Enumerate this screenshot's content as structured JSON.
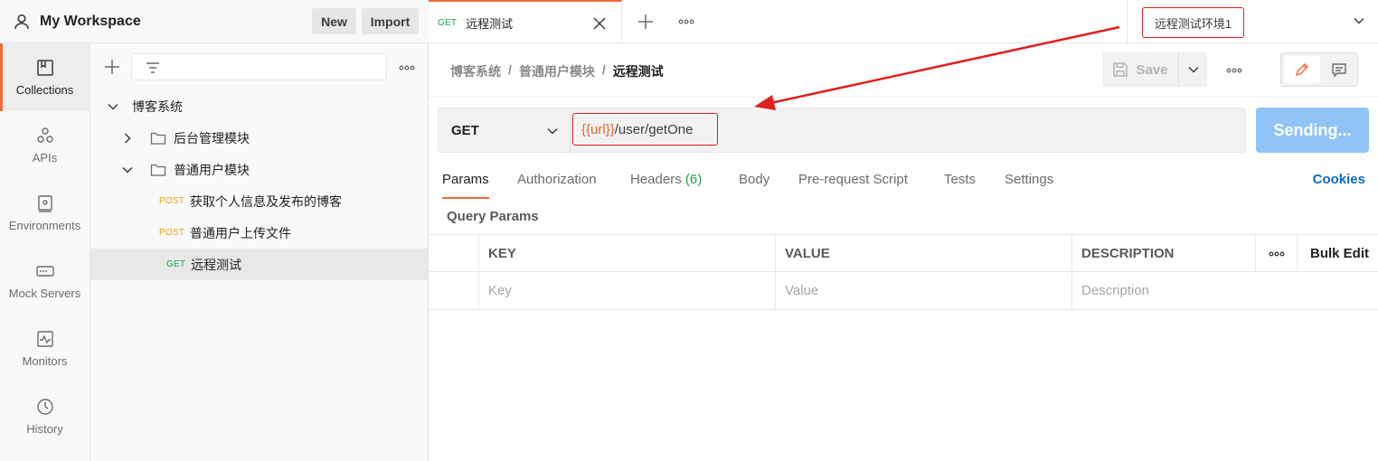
{
  "workspace": {
    "title": "My Workspace",
    "new_label": "New",
    "import_label": "Import"
  },
  "rail": {
    "items": [
      {
        "label": "Collections",
        "icon": "collections-icon",
        "active": true
      },
      {
        "label": "APIs",
        "icon": "apis-icon"
      },
      {
        "label": "Environments",
        "icon": "environments-icon"
      },
      {
        "label": "Mock Servers",
        "icon": "mock-servers-icon"
      },
      {
        "label": "Monitors",
        "icon": "monitors-icon"
      },
      {
        "label": "History",
        "icon": "history-icon"
      }
    ]
  },
  "tree": {
    "collection": "博客系统",
    "folders": [
      {
        "name": "后台管理模块",
        "expanded": false
      },
      {
        "name": "普通用户模块",
        "expanded": true
      }
    ],
    "requests": [
      {
        "method": "POST",
        "name": "获取个人信息及发布的博客"
      },
      {
        "method": "POST",
        "name": "普通用户上传文件"
      },
      {
        "method": "GET",
        "name": "远程测试",
        "selected": true
      }
    ]
  },
  "tab": {
    "method": "GET",
    "title": "远程测试"
  },
  "environment": {
    "selected": "远程测试环境1"
  },
  "breadcrumb": {
    "items": [
      "博客系统",
      "普通用户模块"
    ],
    "sep": "/",
    "current": "远程测试"
  },
  "save": {
    "label": "Save"
  },
  "request": {
    "method": "GET",
    "url_var": "{{url}}",
    "url_path": "/user/getOne",
    "send_label": "Sending..."
  },
  "req_tabs": {
    "params": "Params",
    "authorization": "Authorization",
    "headers": "Headers",
    "headers_count": "(6)",
    "body": "Body",
    "prerequest": "Pre-request Script",
    "tests": "Tests",
    "settings": "Settings",
    "cookies": "Cookies"
  },
  "query_params": {
    "title": "Query Params",
    "columns": {
      "key": "KEY",
      "value": "VALUE",
      "description": "DESCRIPTION",
      "bulk_edit": "Bulk Edit"
    },
    "placeholders": {
      "key": "Key",
      "value": "Value",
      "description": "Description"
    }
  },
  "colors": {
    "accent": "#f26b3a",
    "post": "#e6a800",
    "get": "#1c9e4e",
    "send": "#8fc3f7",
    "annotation": "#e02020",
    "link": "#0a66c9"
  }
}
